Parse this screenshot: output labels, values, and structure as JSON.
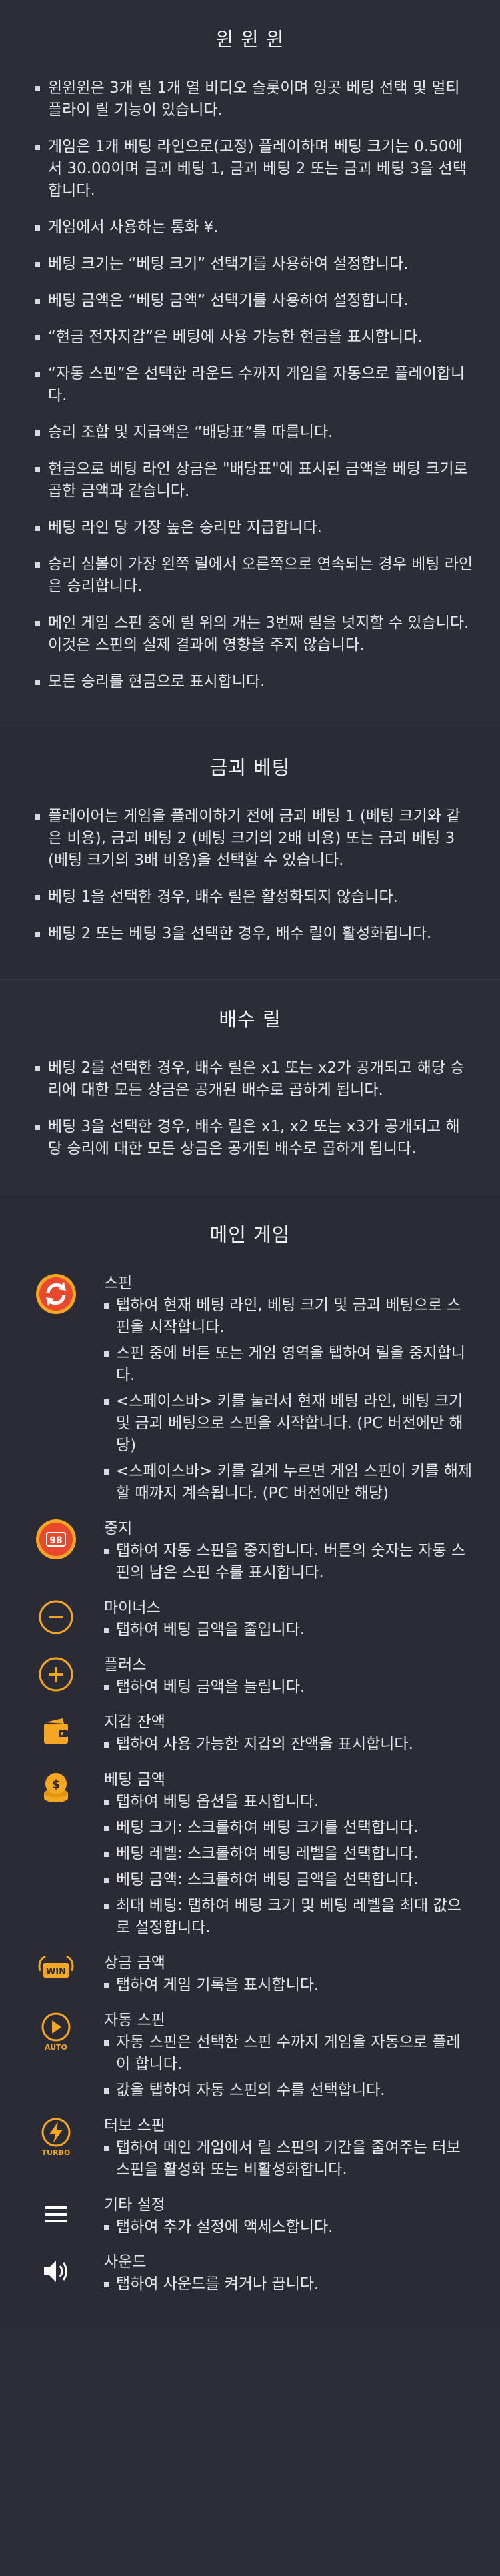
{
  "colors": {
    "background": "#2c2d37",
    "text": "#e6e6ea",
    "accent_orange": "#f5a623",
    "accent_red": "#e8482e"
  },
  "intro": {
    "title": "윈 윈 윈",
    "items": [
      "윈윈윈은 3개 릴 1개 열 비디오 슬롯이며 잉곳 베팅 선택 및 멀티플라이 릴 기능이 있습니다.",
      "게임은 1개 베팅 라인으로(고정) 플레이하며 베팅 크기는 0.50에서 30.00이며 금괴 베팅 1, 금괴 베팅 2 또는 금괴 베팅 3을 선택합니다.",
      "게임에서 사용하는 통화 ¥.",
      "베팅 크기는 “베팅 크기” 선택기를 사용하여 설정합니다.",
      "베팅 금액은 “베팅 금액” 선택기를 사용하여 설정합니다.",
      "“현금 전자지갑”은 베팅에 사용 가능한 현금을 표시합니다.",
      "“자동 스핀”은 선택한 라운드 수까지 게임을 자동으로 플레이합니다.",
      "승리 조합 및 지급액은 “배당표”를 따릅니다.",
      "현금으로 베팅 라인 상금은 \"배당표\"에 표시된 금액을 베팅 크기로 곱한 금액과 같습니다.",
      "베팅 라인 당 가장 높은 승리만 지급합니다.",
      "승리 심볼이 가장 왼쪽 릴에서 오른쪽으로 연속되는 경우 베팅 라인은 승리합니다.",
      "메인 게임 스핀 중에 릴 위의 개는 3번째 릴을 넛지할 수 있습니다. 이것은 스핀의 실제 결과에 영향을 주지 않습니다.",
      "모든 승리를 현금으로 표시합니다."
    ]
  },
  "gold_bet": {
    "title": "금괴 베팅",
    "items": [
      "플레이어는 게임을 플레이하기 전에 금괴 베팅 1 (베팅 크기와 같은 비용), 금괴 베팅 2 (베팅 크기의 2배 비용) 또는 금괴 베팅 3 (베팅 크기의 3배 비용)을 선택할 수 있습니다.",
      "베팅 1을 선택한 경우, 배수 릴은 활성화되지 않습니다.",
      "베팅 2 또는 베팅 3을 선택한 경우, 배수 릴이 활성화됩니다."
    ]
  },
  "multiplier_reel": {
    "title": "배수 릴",
    "items": [
      "베팅 2를 선택한 경우, 배수 릴은 x1 또는 x2가 공개되고 해당 승리에 대한 모든 상금은 공개된 배수로 곱하게 됩니다.",
      "베팅 3을 선택한 경우, 배수 릴은 x1, x2 또는 x3가 공개되고 해당 승리에 대한 모든 상금은 공개된 배수로 곱하게 됩니다."
    ]
  },
  "main_game": {
    "title": "메인 게임",
    "rows": [
      {
        "icon": "spin-icon",
        "title": "스핀",
        "lines": [
          "탭하여 현재 베팅 라인, 베팅 크기 및 금괴 베팅으로 스핀을 시작합니다.",
          "스핀 중에 버튼 또는 게임 영역을 탭하여 릴을 중지합니다.",
          "<스페이스바> 키를 눌러서 현재 베팅 라인, 베팅 크기 및 금괴 베팅으로 스핀을 시작합니다. (PC 버전에만 해당)",
          "<스페이스바> 키를 길게 누르면 게임 스핀이 키를 해제할 때까지 계속됩니다. (PC 버전에만 해당)"
        ]
      },
      {
        "icon": "stop-icon",
        "icon_text": "98",
        "title": "중지",
        "lines": [
          "탭하여 자동 스핀을 중지합니다. 버튼의 숫자는 자동 스핀의 남은 스핀 수를 표시합니다."
        ]
      },
      {
        "icon": "minus-icon",
        "title": "마이너스",
        "lines": [
          "탭하여 베팅 금액을 줄입니다."
        ]
      },
      {
        "icon": "plus-icon",
        "title": "플러스",
        "lines": [
          "탭하여 베팅 금액을 늘립니다."
        ]
      },
      {
        "icon": "wallet-icon",
        "title": "지갑 잔액",
        "lines": [
          "탭하여 사용 가능한 지갑의 잔액을 표시합니다."
        ]
      },
      {
        "icon": "coins-icon",
        "title": "베팅 금액",
        "lines": [
          "탭하여 베팅 옵션을 표시합니다.",
          "베팅 크기: 스크롤하여 베팅 크기를 선택합니다.",
          "베팅 레벨: 스크롤하여 베팅 레벨을 선택합니다.",
          "베팅 금액: 스크롤하여 베팅 금액을 선택합니다.",
          "최대 베팅: 탭하여 베팅 크기 및 베팅 레벨을 최대 값으로 설정합니다."
        ]
      },
      {
        "icon": "win-icon",
        "icon_text": "WIN",
        "title": "상금 금액",
        "lines": [
          "탭하여 게임 기록을 표시합니다."
        ]
      },
      {
        "icon": "auto-spin-icon",
        "icon_text": "AUTO",
        "title": "자동 스핀",
        "lines": [
          "자동 스핀은 선택한 스핀 수까지 게임을 자동으로 플레이 합니다.",
          "값을 탭하여 자동 스핀의 수를 선택합니다."
        ]
      },
      {
        "icon": "turbo-spin-icon",
        "icon_text": "TURBO",
        "title": "터보 스핀",
        "lines": [
          "탭하여 메인 게임에서 릴 스핀의 기간을 줄여주는 터보 스핀을 활성화 또는 비활성화합니다."
        ]
      },
      {
        "icon": "menu-icon",
        "title": "기타 설정",
        "lines": [
          "탭하여 추가 설정에 액세스합니다."
        ]
      },
      {
        "icon": "sound-icon",
        "title": "사운드",
        "lines": [
          "탭하여 사운드를 켜거나 끕니다."
        ]
      }
    ]
  }
}
